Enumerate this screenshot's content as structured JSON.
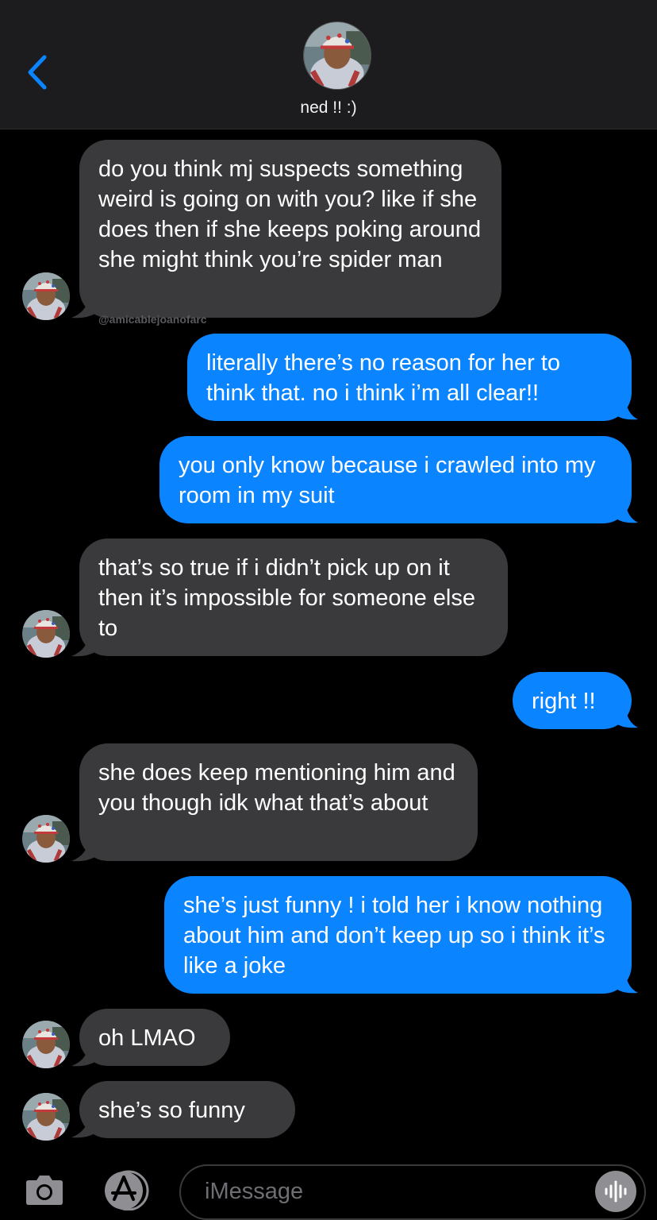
{
  "header": {
    "contact_name": "ned !! :)"
  },
  "messages": [
    {
      "direction": "in",
      "text": "do you think mj suspects something weird is going on with you? like if she does then if she keeps poking around she might think you’re spider man"
    },
    {
      "direction": "out",
      "text": "literally there’s no reason for her to think that. no i think i’m all clear!!"
    },
    {
      "direction": "out",
      "text": "you only know because i crawled into my room in my suit"
    },
    {
      "direction": "in",
      "text": "that’s so true if i didn’t pick up on it then it’s impossible for someone else to"
    },
    {
      "direction": "out",
      "text": "right !!"
    },
    {
      "direction": "in",
      "text": "she does keep mentioning him and you though idk what that’s about"
    },
    {
      "direction": "out",
      "text": "she’s just funny ! i told her i know nothing about him and don’t keep up so i think it’s like a joke"
    },
    {
      "direction": "in",
      "text": "oh LMAO"
    },
    {
      "direction": "in",
      "text": "she’s so funny"
    }
  ],
  "watermark": "@amicablejoanofarc",
  "input": {
    "placeholder": "iMessage"
  },
  "colors": {
    "incoming_bubble": "#3a3a3c",
    "outgoing_bubble": "#0a84ff",
    "accent": "#0a84ff",
    "background": "#000000",
    "header_background": "#1c1c1e"
  },
  "icons": {
    "back": "chevron-left-icon",
    "camera": "camera-icon",
    "app_store": "app-store-icon",
    "audio": "audio-waveform-icon"
  }
}
